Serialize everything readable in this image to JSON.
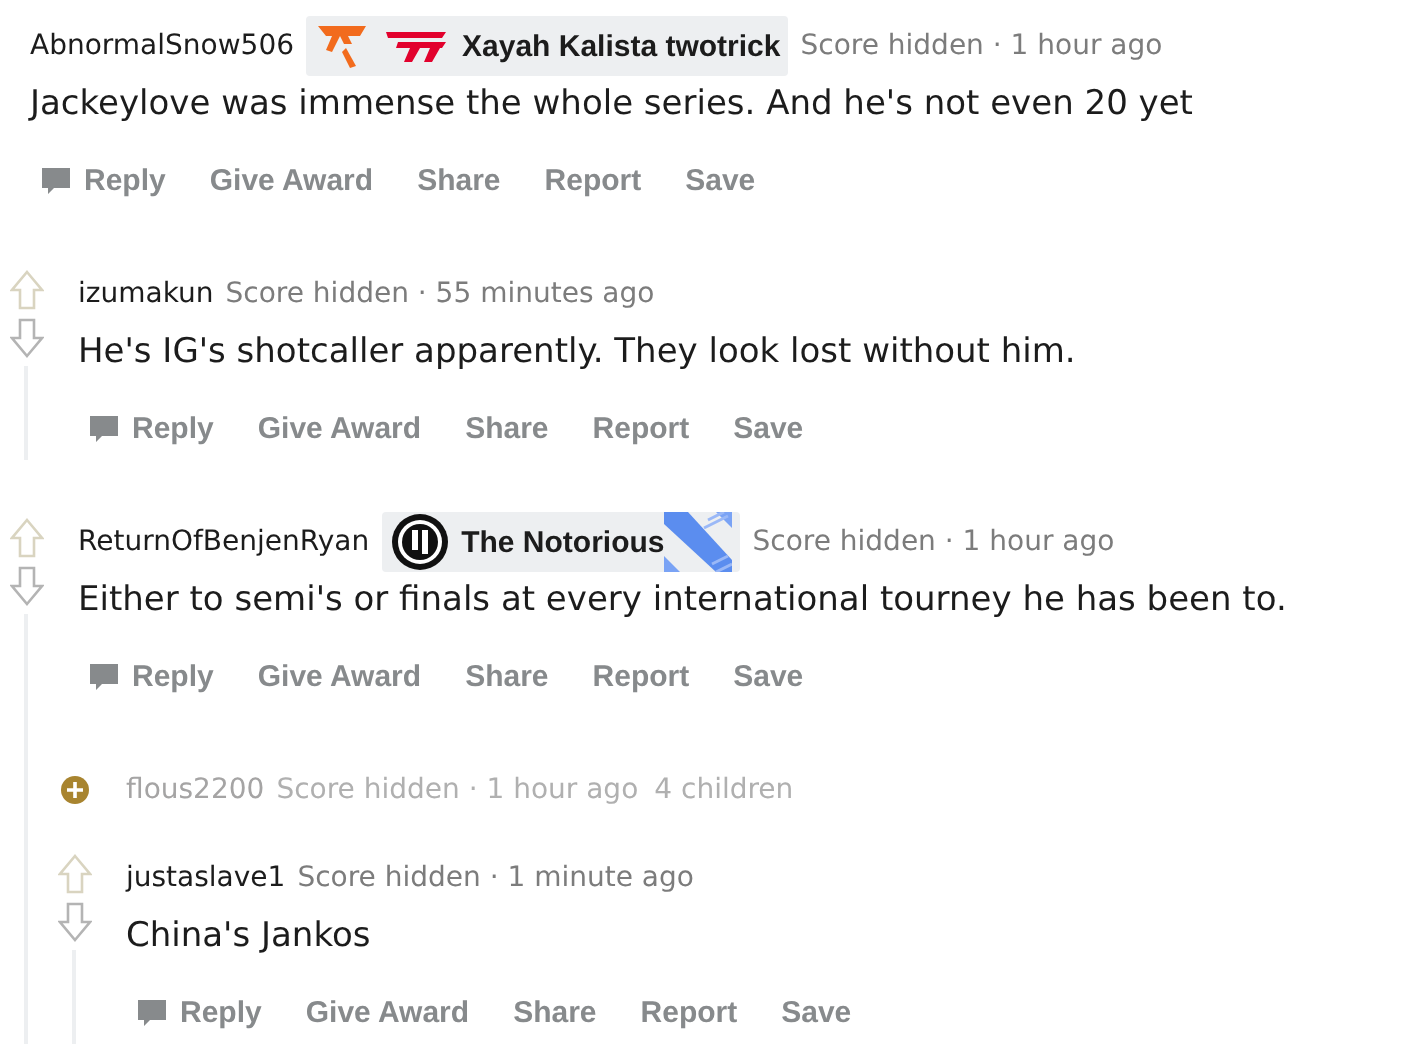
{
  "comments": [
    {
      "kind": "partial",
      "author": "AbnormalSnow506",
      "flair": {
        "kind": "fnc-t1",
        "text": "Xayah Kalista twotrick"
      },
      "meta": "Score hidden · 1 hour ago",
      "body": "Jackeylove was immense the whole series. And he's not even 20 yet",
      "actions": [
        "Reply",
        "Give Award",
        "Share",
        "Report",
        "Save"
      ],
      "children": [
        {
          "kind": "comment",
          "author": "izumakun",
          "meta": "Score hidden · 55 minutes ago",
          "body": "He's IG's shotcaller apparently. They look lost without him.",
          "actions": [
            "Reply",
            "Give Award",
            "Share",
            "Report",
            "Save"
          ]
        },
        {
          "kind": "comment",
          "author": "ReturnOfBenjenRyan",
          "flair": {
            "kind": "ig",
            "text": "The Notorious"
          },
          "meta": "Score hidden · 1 hour ago",
          "body": "Either to semi's or finals at every international tourney he has been to.",
          "actions": [
            "Reply",
            "Give Award",
            "Share",
            "Report",
            "Save"
          ],
          "children": [
            {
              "kind": "collapsed",
              "author": "flous2200",
              "meta": "Score hidden · 1 hour ago",
              "count": "4 children"
            },
            {
              "kind": "comment",
              "author": "justaslave1",
              "meta": "Score hidden · 1 minute ago",
              "body": "China's Jankos",
              "actions": [
                "Reply",
                "Give Award",
                "Share",
                "Report",
                "Save"
              ]
            }
          ]
        }
      ]
    }
  ]
}
